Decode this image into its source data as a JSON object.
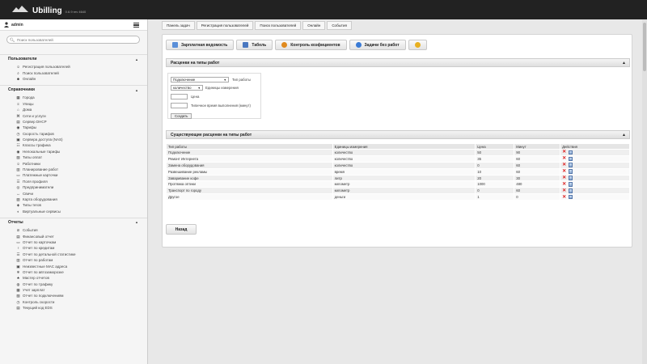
{
  "app": {
    "name": "Ubilling",
    "version": "0.6.9 rev 4640"
  },
  "user": {
    "name": "admin"
  },
  "search": {
    "placeholder": "Поиск пользователей"
  },
  "sidebar": {
    "sections": [
      {
        "title": "Пользователи",
        "items": [
          {
            "label": "Регистрация пользователей",
            "icon": "user-add-icon"
          },
          {
            "label": "Поиск пользователей",
            "icon": "search-icon"
          },
          {
            "label": "Онлайн",
            "icon": "user-online-icon"
          }
        ]
      },
      {
        "title": "Справочники",
        "items": [
          {
            "label": "Города",
            "icon": "city-icon"
          },
          {
            "label": "Улицы",
            "icon": "street-icon"
          },
          {
            "label": "Дома",
            "icon": "house-icon"
          },
          {
            "label": "Сети и услуги",
            "icon": "network-icon"
          },
          {
            "label": "Сервер DHCP",
            "icon": "server-icon"
          },
          {
            "label": "Тарифы",
            "icon": "tariff-icon"
          },
          {
            "label": "Скорость тарифов",
            "icon": "speed-icon"
          },
          {
            "label": "Сервера доступа (NAS)",
            "icon": "nas-icon"
          },
          {
            "label": "Классы трафика",
            "icon": "traffic-class-icon"
          },
          {
            "label": "Нелокальные тарифы",
            "icon": "tariff-icon"
          },
          {
            "label": "Типы оплат",
            "icon": "payment-type-icon"
          },
          {
            "label": "Работники",
            "icon": "worker-icon"
          },
          {
            "label": "Планирование работ",
            "icon": "planning-icon"
          },
          {
            "label": "Платежные карточки",
            "icon": "card-icon"
          },
          {
            "label": "Поля профиля",
            "icon": "profile-fields-icon"
          },
          {
            "label": "Предприниматели",
            "icon": "entrepreneur-icon"
          },
          {
            "label": "Свичи",
            "icon": "switch-icon"
          },
          {
            "label": "Карта оборудования",
            "icon": "map-icon"
          },
          {
            "label": "Типы тегов",
            "icon": "tag-icon"
          },
          {
            "label": "Виртуальные сервисы",
            "icon": "virtual-service-icon"
          }
        ]
      },
      {
        "title": "Отчеты",
        "items": [
          {
            "label": "События",
            "icon": "events-icon"
          },
          {
            "label": "Финансовый отчет",
            "icon": "finance-icon"
          },
          {
            "label": "Отчет по карточкам",
            "icon": "card-icon"
          },
          {
            "label": "Отчет по кредитам",
            "icon": "credit-icon"
          },
          {
            "label": "Отчет по детальной статистике",
            "icon": "stats-icon"
          },
          {
            "label": "Отчет по работам",
            "icon": "report-icon"
          },
          {
            "label": "Неизвестные MAC адреса",
            "icon": "mac-icon"
          },
          {
            "label": "Отчет по автозаморозке",
            "icon": "freeze-icon"
          },
          {
            "label": "Мастер отчетов",
            "icon": "wizard-icon"
          },
          {
            "label": "Отчет по трафику",
            "icon": "traffic-icon"
          },
          {
            "label": "Учет зарплат",
            "icon": "salary-icon"
          },
          {
            "label": "Отчет по подключениям",
            "icon": "connection-icon"
          },
          {
            "label": "Контроль скорости",
            "icon": "speed-control-icon"
          },
          {
            "label": "Текущий код EDS",
            "icon": "code-icon"
          }
        ]
      }
    ]
  },
  "tabs": [
    "Панель задач",
    "Регистрация пользователей",
    "Поиск пользователей",
    "Онлайн",
    "События"
  ],
  "toolbar": [
    {
      "label": "Зарплатная ведомость",
      "icon": "payroll-icon",
      "color": "#5a8fd8"
    },
    {
      "label": "Табель",
      "icon": "timesheet-icon",
      "color": "#4a78c0"
    },
    {
      "label": "Контроль коэфициентов",
      "icon": "coefficient-icon",
      "color": "#e08a1e"
    },
    {
      "label": "Задачи без работ",
      "icon": "help-icon",
      "color": "#3a7bd5"
    },
    {
      "label": "",
      "icon": "gear-icon",
      "color": "#e8b020"
    }
  ],
  "rates_section": {
    "title": "Расценки на типы работ"
  },
  "form": {
    "work_type_value": "Подключение",
    "work_type_label": "Тип работы",
    "unit_value": "количество",
    "unit_label": "Единицы измерения",
    "price_label": "Цена",
    "time_label": "Типичное время выполнения (минут)",
    "create_label": "Создать"
  },
  "existing_section": {
    "title": "Существующие расценки на типы работ"
  },
  "table": {
    "headers": [
      "Тип работы",
      "Единицы измерения",
      "Цена",
      "Минут",
      "Действия"
    ],
    "rows": [
      [
        "Подключение",
        "количество",
        "50",
        "90"
      ],
      [
        "Ремонт Интернета",
        "количество",
        "35",
        "60"
      ],
      [
        "Замена оборудования",
        "количество",
        "0",
        "60"
      ],
      [
        "Развешивание рекламы",
        "время",
        "10",
        "60"
      ],
      [
        "Заваривание кофе",
        "литр",
        "20",
        "30"
      ],
      [
        "Протяжка оптики",
        "километр",
        "1000",
        "480"
      ],
      [
        "Транспорт по городу",
        "километр",
        "0",
        "60"
      ],
      [
        "Другое",
        "деньги",
        "1",
        "0"
      ]
    ]
  },
  "back_button": {
    "label": "Назад"
  }
}
